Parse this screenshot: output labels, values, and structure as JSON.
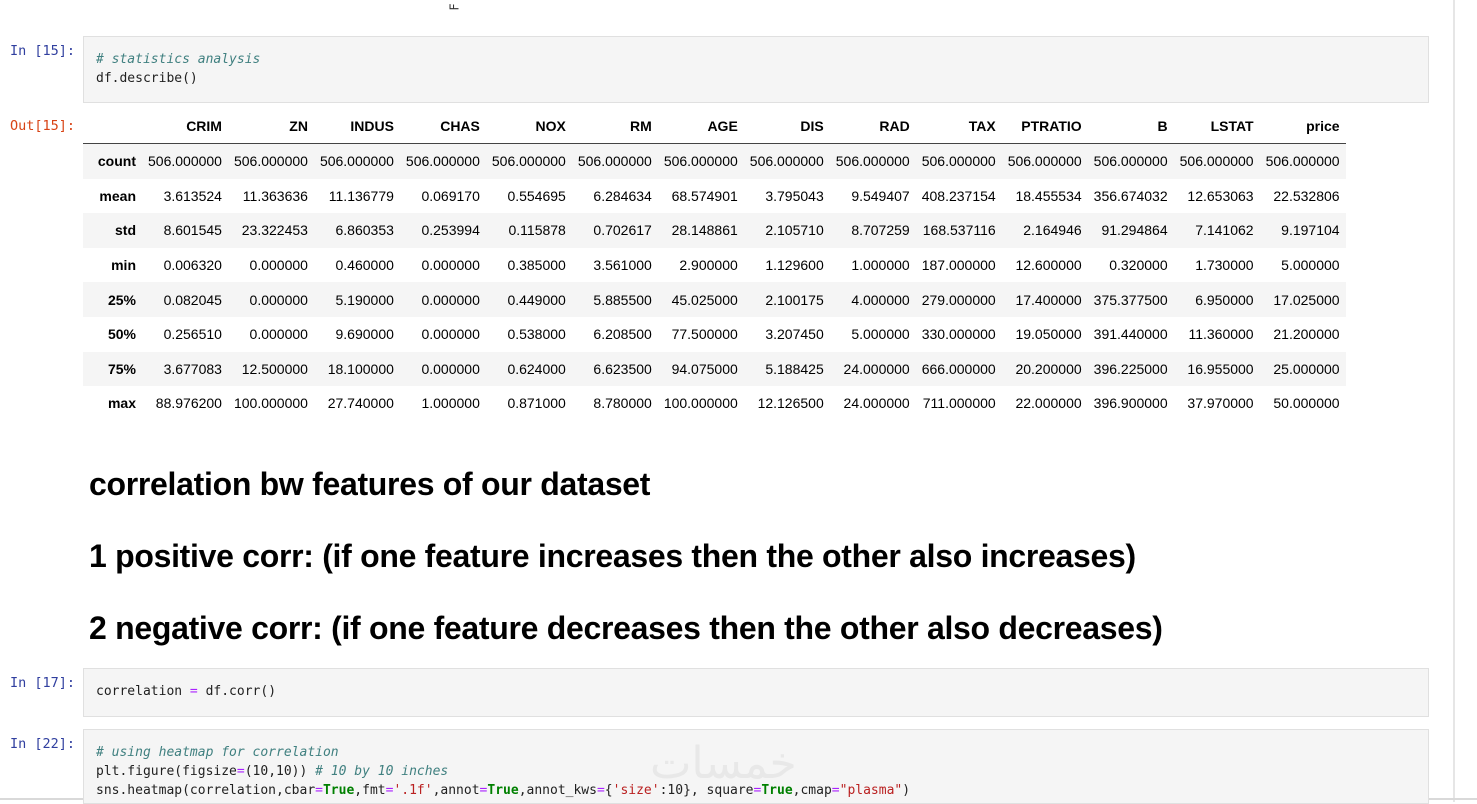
{
  "top_glyph": "F",
  "cells": {
    "in15": {
      "prompt": "In [15]:",
      "line1": "# statistics analysis",
      "line2": "df.describe()"
    },
    "out15": {
      "prompt": "Out[15]:",
      "columns": [
        "",
        "CRIM",
        "ZN",
        "INDUS",
        "CHAS",
        "NOX",
        "RM",
        "AGE",
        "DIS",
        "RAD",
        "TAX",
        "PTRATIO",
        "B",
        "LSTAT",
        "price"
      ],
      "rows": [
        {
          "label": "count",
          "values": [
            "506.000000",
            "506.000000",
            "506.000000",
            "506.000000",
            "506.000000",
            "506.000000",
            "506.000000",
            "506.000000",
            "506.000000",
            "506.000000",
            "506.000000",
            "506.000000",
            "506.000000",
            "506.000000"
          ]
        },
        {
          "label": "mean",
          "values": [
            "3.613524",
            "11.363636",
            "11.136779",
            "0.069170",
            "0.554695",
            "6.284634",
            "68.574901",
            "3.795043",
            "9.549407",
            "408.237154",
            "18.455534",
            "356.674032",
            "12.653063",
            "22.532806"
          ]
        },
        {
          "label": "std",
          "values": [
            "8.601545",
            "23.322453",
            "6.860353",
            "0.253994",
            "0.115878",
            "0.702617",
            "28.148861",
            "2.105710",
            "8.707259",
            "168.537116",
            "2.164946",
            "91.294864",
            "7.141062",
            "9.197104"
          ]
        },
        {
          "label": "min",
          "values": [
            "0.006320",
            "0.000000",
            "0.460000",
            "0.000000",
            "0.385000",
            "3.561000",
            "2.900000",
            "1.129600",
            "1.000000",
            "187.000000",
            "12.600000",
            "0.320000",
            "1.730000",
            "5.000000"
          ]
        },
        {
          "label": "25%",
          "values": [
            "0.082045",
            "0.000000",
            "5.190000",
            "0.000000",
            "0.449000",
            "5.885500",
            "45.025000",
            "2.100175",
            "4.000000",
            "279.000000",
            "17.400000",
            "375.377500",
            "6.950000",
            "17.025000"
          ]
        },
        {
          "label": "50%",
          "values": [
            "0.256510",
            "0.000000",
            "9.690000",
            "0.000000",
            "0.538000",
            "6.208500",
            "77.500000",
            "3.207450",
            "5.000000",
            "330.000000",
            "19.050000",
            "391.440000",
            "11.360000",
            "21.200000"
          ]
        },
        {
          "label": "75%",
          "values": [
            "3.677083",
            "12.500000",
            "18.100000",
            "0.000000",
            "0.624000",
            "6.623500",
            "94.075000",
            "5.188425",
            "24.000000",
            "666.000000",
            "20.200000",
            "396.225000",
            "16.955000",
            "25.000000"
          ]
        },
        {
          "label": "max",
          "values": [
            "88.976200",
            "100.000000",
            "27.740000",
            "1.000000",
            "0.871000",
            "8.780000",
            "100.000000",
            "12.126500",
            "24.000000",
            "711.000000",
            "22.000000",
            "396.900000",
            "37.970000",
            "50.000000"
          ]
        }
      ]
    },
    "markdown": {
      "h1": "correlation bw features of our dataset",
      "h2": "1 positive corr: (if one feature increases then the other also increases)",
      "h3": "2 negative corr: (if one feature decreases then the other also decreases)"
    },
    "in17": {
      "prompt": "In [17]:",
      "var": "correlation",
      "eq": "=",
      "expr": "df.corr()"
    },
    "in22": {
      "prompt": "In [22]:",
      "comment": "# using heatmap for correlation",
      "l2_a": "plt.figure(figsize",
      "l2_eq": "=",
      "l2_b": "(10,10)) ",
      "l2_cm": "# 10 by 10 inches",
      "l3_a": "sns.heatmap(correlation,cbar",
      "l3_true1": "True",
      "l3_b": ",fmt",
      "l3_s1": "'.1f'",
      "l3_c": ",annot",
      "l3_true2": "True",
      "l3_d": ",annot_kws",
      "l3_e": "{",
      "l3_s2": "'size'",
      "l3_f": ":10}, square",
      "l3_true3": "True",
      "l3_g": ",cmap",
      "l3_s3": "\"plasma\"",
      "l3_h": ")"
    }
  },
  "watermark": "خمسات"
}
